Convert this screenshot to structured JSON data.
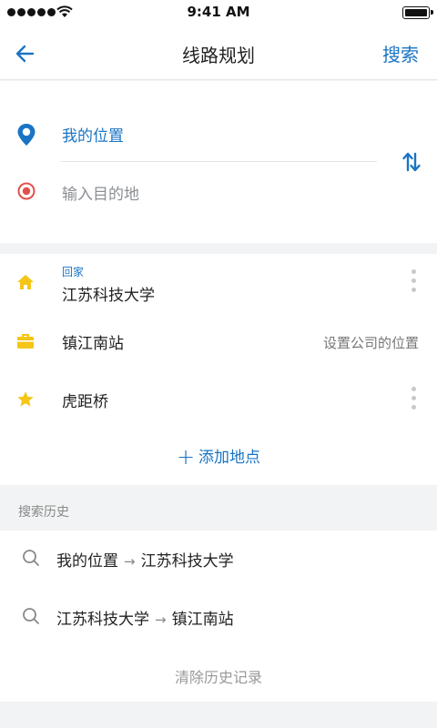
{
  "status_bar": {
    "time": "9:41 AM",
    "icons": [
      "signal-dots-icon",
      "wifi-icon",
      "battery-icon"
    ]
  },
  "nav": {
    "back_icon": "arrow-left-icon",
    "title": "线路规划",
    "search_label": "搜索"
  },
  "route": {
    "origin_label": "我的位置",
    "destination_placeholder": "输入目的地",
    "origin_icon": "location-pin-icon",
    "destination_icon": "target-circle-icon",
    "swap_icon": "swap-vertical-icon"
  },
  "places": {
    "items": [
      {
        "tag": "回家",
        "name": "江苏科技大学",
        "hint": "",
        "icon": "home-icon"
      },
      {
        "tag": "",
        "name": "镇江南站",
        "hint": "设置公司的位置",
        "icon": "briefcase-icon"
      },
      {
        "tag": "",
        "name": "虎距桥",
        "hint": "",
        "icon": "star-icon"
      }
    ],
    "add_label": "添加地点",
    "add_icon": "plus-icon"
  },
  "history": {
    "header": "搜索历史",
    "items": [
      {
        "from": "我的位置",
        "to": "江苏科技大学"
      },
      {
        "from": "江苏科技大学",
        "to": "镇江南站"
      }
    ],
    "arrow": "→",
    "clear_label": "清除历史记录"
  },
  "colors": {
    "accent_blue": "#1a74c4",
    "destination_red": "#e2504c",
    "icon_yellow": "#f5c518",
    "background": "#f2f3f4"
  }
}
